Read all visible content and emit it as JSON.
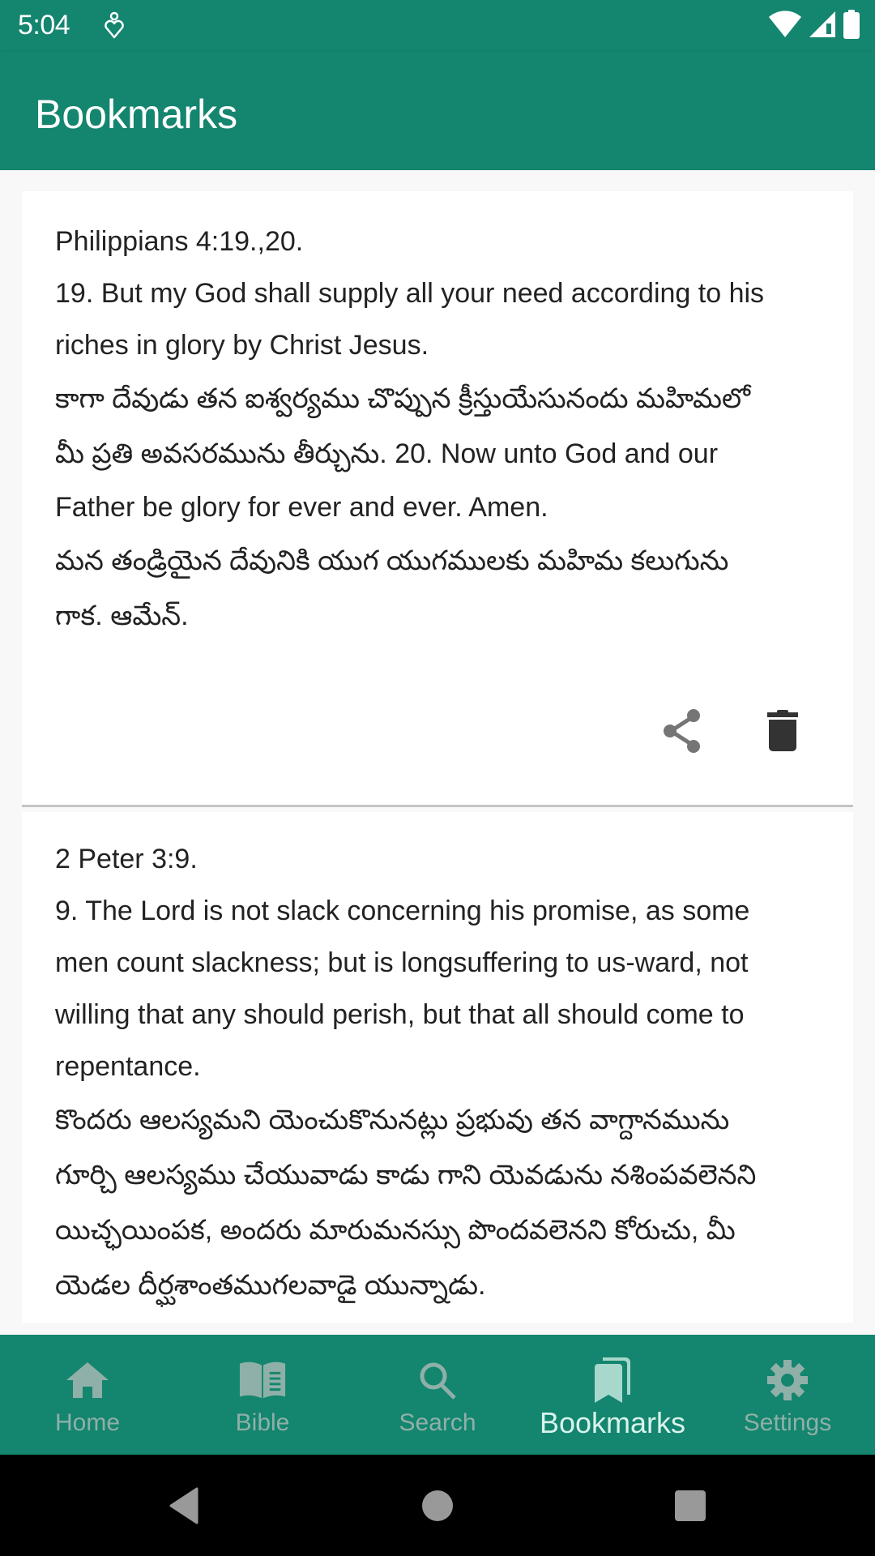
{
  "status_bar": {
    "time": "5:04",
    "icons": [
      "notification-heart-icon",
      "wifi-icon",
      "cellular-signal-icon",
      "battery-icon"
    ]
  },
  "app_bar": {
    "title": "Bookmarks"
  },
  "bookmarks": [
    {
      "reference": "Philippians 4:19.,20.",
      "lines": [
        "19. But my God shall supply all your need according to his",
        "riches in glory by Christ Jesus.",
        "కాగా దేవుడు తన ఐశ్వర్యము చొప్పున క్రీస్తుయేసునందు మహిమలో",
        "మీ ప్రతి అవసరమును తీర్చును. 20. Now unto God and our",
        "Father be glory for ever and ever. Amen.",
        "మన తండ్రియైన దేవునికి యుగ యుగములకు మహిమ కలుగును",
        "గాక. ఆమేన్."
      ],
      "actions": {
        "share": "share-icon",
        "delete": "delete-icon"
      }
    },
    {
      "reference": "2 Peter 3:9.",
      "lines": [
        "9. The Lord is not slack concerning his promise, as some",
        "men count slackness; but is longsuffering to us-ward, not",
        "willing that any should perish, but that all should come to",
        "repentance.",
        "కొందరు ఆలస్యమని యెంచుకొనునట్లు ప్రభువు తన వాగ్దానమును",
        "గూర్చి ఆలస్యము చేయువాడు కాడు గాని యెవడును నశింపవలెనని",
        "యిచ్ఛయింపక, అందరు మారుమనస్సు పొందవలెనని కోరుచు, మీ",
        "యెడల దీర్ఘశాంతముగలవాడై యున్నాడు."
      ]
    }
  ],
  "bottom_nav": {
    "items": [
      {
        "label": "Home",
        "icon": "home-icon",
        "active": false
      },
      {
        "label": "Bible",
        "icon": "bible-icon",
        "active": false
      },
      {
        "label": "Search",
        "icon": "search-icon",
        "active": false
      },
      {
        "label": "Bookmarks",
        "icon": "bookmarks-icon",
        "active": true
      },
      {
        "label": "Settings",
        "icon": "settings-icon",
        "active": false
      }
    ]
  },
  "system_nav": {
    "buttons": [
      "back",
      "home",
      "recents"
    ]
  },
  "colors": {
    "primary": "#14856e",
    "nav_inactive": "#8fb0a8",
    "nav_active": "#d8f3ec",
    "text": "#222222",
    "background": "#f8f8f8"
  }
}
